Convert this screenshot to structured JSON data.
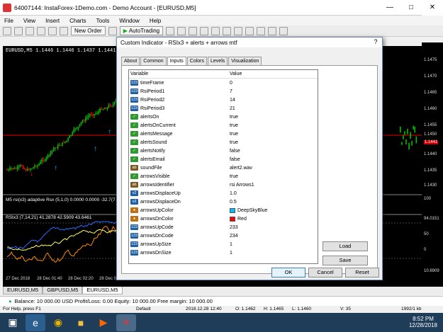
{
  "window": {
    "title": "64007144: InstaForex-1Demo.com - Demo Account - [EURUSD,M5]"
  },
  "menu": [
    "File",
    "View",
    "Insert",
    "Charts",
    "Tools",
    "Window",
    "Help"
  ],
  "toolbar": {
    "new_order": "New Order",
    "autotrading": "AutoTrading"
  },
  "chart": {
    "header": "EURUSD,M5  1.1446 1.1446 1.1437 1.1441",
    "sub1": "M5 rsi(x3) adaptive Rsx (5,1,0) 0.0000 0.0000 -32.7(7",
    "sub2": "RSIx3 (7,14,21) 41.2878 42.5909 43.6461",
    "prices": [
      "1.1475",
      "1.1470",
      "1.1465",
      "1.1460",
      "1.1455",
      "1.1450",
      "1.1445",
      "1.1441",
      "1.1440",
      "1.1435",
      "1.1430",
      "1.1425",
      "100",
      "94.0151",
      "50",
      "0",
      "10.6909",
      "0.00"
    ],
    "times": [
      "27 Dec 2018",
      "28 Dec 01:40",
      "28 Dec 02:20",
      "28 Dec 03:40"
    ],
    "bull_color": "#00c000",
    "bear_color": "#ff0000",
    "line_color": "#ff0000"
  },
  "chart_tabs": [
    "EURUSD,M5",
    "GBPUSD,M5",
    "EURUSD,M5"
  ],
  "balance": "Balance: 10 000.00 USD  Profit/Loss: 0.00  Equity: 10 000.00  Free margin: 10 000.00",
  "status": {
    "help": "For Help, press F1",
    "profile": "Default",
    "datetime": "2018.12.28 12:40",
    "o": "O: 1.1462",
    "h": "H: 1.1465",
    "l": "L: 1.1460",
    "v": "V: 35",
    "kb": "1992/1 kb"
  },
  "clock": {
    "time": "8:52 PM",
    "date": "12/28/2018"
  },
  "dialog": {
    "title": "Custom Indicator - RSIx3 + alerts + arrows mtf",
    "close": "?",
    "tabs": [
      "About",
      "Common",
      "Inputs",
      "Colors",
      "Levels",
      "Visualization"
    ],
    "active_tab": "Inputs",
    "col_variable": "Variable",
    "col_value": "Value",
    "rows": [
      {
        "type": "int",
        "name": "timeFrame",
        "value": "0"
      },
      {
        "type": "int",
        "name": "RsiPeriod1",
        "value": "7"
      },
      {
        "type": "int",
        "name": "RsiPeriod2",
        "value": "14"
      },
      {
        "type": "int",
        "name": "RsiPeriod3",
        "value": "21"
      },
      {
        "type": "bool",
        "name": "alertsOn",
        "value": "true"
      },
      {
        "type": "bool",
        "name": "alertsOnCurrent",
        "value": "true"
      },
      {
        "type": "bool",
        "name": "alertsMessage",
        "value": "true"
      },
      {
        "type": "bool",
        "name": "alertsSound",
        "value": "true"
      },
      {
        "type": "bool",
        "name": "alertsNotify",
        "value": "false"
      },
      {
        "type": "bool",
        "name": "alertsEmail",
        "value": "false"
      },
      {
        "type": "str",
        "name": "soundFile",
        "value": "alert2.wav"
      },
      {
        "type": "bool",
        "name": "arrowsVisible",
        "value": "true"
      },
      {
        "type": "str",
        "name": "arrowsIdentifier",
        "value": "rsi Arrows1"
      },
      {
        "type": "dbl",
        "name": "arrowsDisplaceUp",
        "value": "1.0"
      },
      {
        "type": "dbl",
        "name": "arrowsDisplaceDn",
        "value": "0.5"
      },
      {
        "type": "clr",
        "name": "arrowsUpColor",
        "value": "DeepSkyBlue",
        "swatch": "#00bfff"
      },
      {
        "type": "clr",
        "name": "arrowsDnColor",
        "value": "Red",
        "swatch": "#ff0000"
      },
      {
        "type": "int",
        "name": "arrowsUpCode",
        "value": "233"
      },
      {
        "type": "int",
        "name": "arrowsDnCode",
        "value": "234"
      },
      {
        "type": "int",
        "name": "arrowsUpSize",
        "value": "1"
      },
      {
        "type": "int",
        "name": "arrowsDnSize",
        "value": "1"
      }
    ],
    "buttons": {
      "load": "Load",
      "save": "Save",
      "ok": "OK",
      "cancel": "Cancel",
      "reset": "Reset"
    }
  }
}
